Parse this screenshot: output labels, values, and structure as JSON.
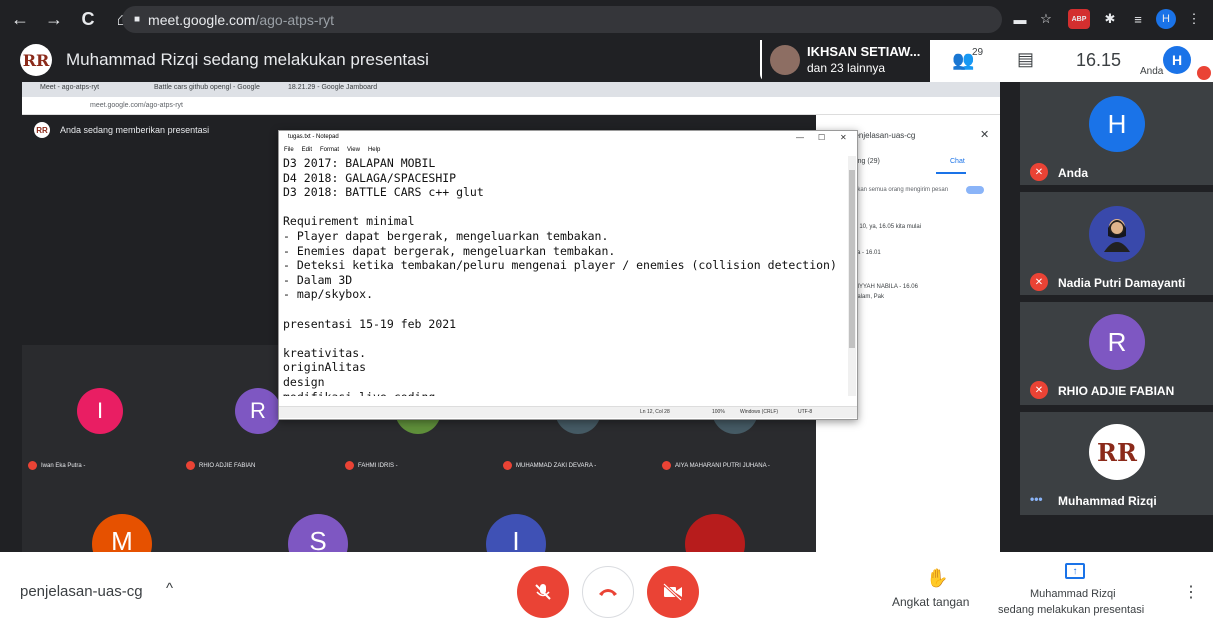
{
  "browser": {
    "back_icon": "←",
    "forward_icon": "→",
    "reload_icon": "C",
    "home_icon": "⌂",
    "lock_icon": "🔒",
    "url_host": "meet.google.com",
    "url_path": "/ago-atps-ryt",
    "cast_icon": "▬",
    "star_icon": "☆",
    "abp_label": "ABP",
    "puzzle_icon": "✱",
    "list_icon": "≡",
    "profile_initial": "H",
    "menu_icon": "⋮"
  },
  "header": {
    "presenter_logo": "RR",
    "title": "Muhammad Rizqi sedang melakukan presentasi",
    "people_name": "IKHSAN SETIAW...",
    "people_others": "dan 23 lainnya",
    "people_icon": "👥",
    "people_count": "29",
    "chat_icon": "▤",
    "clock": "16.15",
    "self_label": "Anda",
    "self_initial": "H"
  },
  "shared_screen": {
    "tabs": [
      "Meet - ago-atps-ryt",
      "Battle cars github opengl - Google",
      "18.21.29 - Google Jamboard"
    ],
    "url": "meet.google.com/ago-atps-ryt",
    "caption": "Anda sedang memberikan presentasi",
    "logo": "RR",
    "notepad": {
      "title": "tugas.txt - Notepad",
      "menu": [
        "File",
        "Edit",
        "Format",
        "View",
        "Help"
      ],
      "lines": [
        "D3 2017: BALAPAN MOBIL",
        "D4 2018: GALAGA/SPACESHIP",
        "D3 2018: BATTLE CARS c++ glut",
        "",
        "Requirement minimal",
        "- Player dapat bergerak, mengeluarkan tembakan.",
        "- Enemies dapat bergerak, mengeluarkan tembakan.",
        "- Deteksi ketika tembakan/peluru mengenai player / enemies (collision detection)",
        "- Dalam 3D",
        "- map/skybox.",
        "",
        "presentasi 15-19 feb 2021",
        "",
        "kreativitas.",
        "originAlitas",
        "design",
        "modifikasi live coding."
      ],
      "status": [
        "Ln 12, Col 28",
        "100%",
        "Windows (CRLF)",
        "UTF-8"
      ]
    },
    "chat_panel": {
      "title": "penjelasan-uas-cg",
      "tab_people": "Orang (29)",
      "tab_chat": "Chat",
      "toggle_label": "Izinkan semua orang mengirim pesan",
      "messages": [
        "stat 10, ya, 16.05 kita mulai",
        "rafra - 16.01",
        "ISTIYYAH NABILA - 16.06",
        "assalam, Pak"
      ]
    },
    "grid_tiles": [
      {
        "initial": "I",
        "color": "#e91e63",
        "name": "Iwan Eka Putra -"
      },
      {
        "initial": "R",
        "color": "#7e57c2",
        "name": "RHIO ADJIE FABIAN"
      },
      {
        "initial": "",
        "color": "#5f8f3a",
        "name": "FAHMI IDRIS -"
      },
      {
        "initial": "",
        "color": "#455a64",
        "name": "MUHAMMAD ZAKI DEVARA -"
      },
      {
        "initial": "",
        "color": "#455a64",
        "name": "AIYA MAHARANI PUTRI JUHANA -"
      }
    ],
    "grid_row2": [
      {
        "initial": "M",
        "color": "#e65100"
      },
      {
        "initial": "S",
        "color": "#7e57c2"
      },
      {
        "initial": "I",
        "color": "#3f51b5"
      },
      {
        "initial": "",
        "color": "#b71c1c"
      }
    ]
  },
  "participants": [
    {
      "initial": "H",
      "color": "#1a73e8",
      "name": "Anda",
      "muted": true
    },
    {
      "initial": "",
      "color": "#5c6bc0",
      "name": "Nadia Putri Damayanti",
      "muted": true
    },
    {
      "initial": "R",
      "color": "#7e57c2",
      "name": "RHIO ADJIE FABIAN",
      "muted": true
    },
    {
      "initial": "RR",
      "color": "#ffffff",
      "name": "Muhammad Rizqi",
      "muted": false
    }
  ],
  "participant_more": "•••",
  "bottom": {
    "meeting_code": "penjelasan-uas-cg",
    "chevron": "^",
    "mic_icon": "🎙",
    "end_call_icon": "☎",
    "camera_icon": "⊘",
    "hand_icon": "✋",
    "hand_label": "Angkat tangan",
    "present_icon": "↑",
    "present_line1": "Muhammad Rizqi",
    "present_line2": "sedang melakukan presentasi",
    "more_icon": "⋮"
  },
  "colors": {
    "red": "#ea4335",
    "blue": "#1a73e8",
    "dark": "#202124"
  }
}
